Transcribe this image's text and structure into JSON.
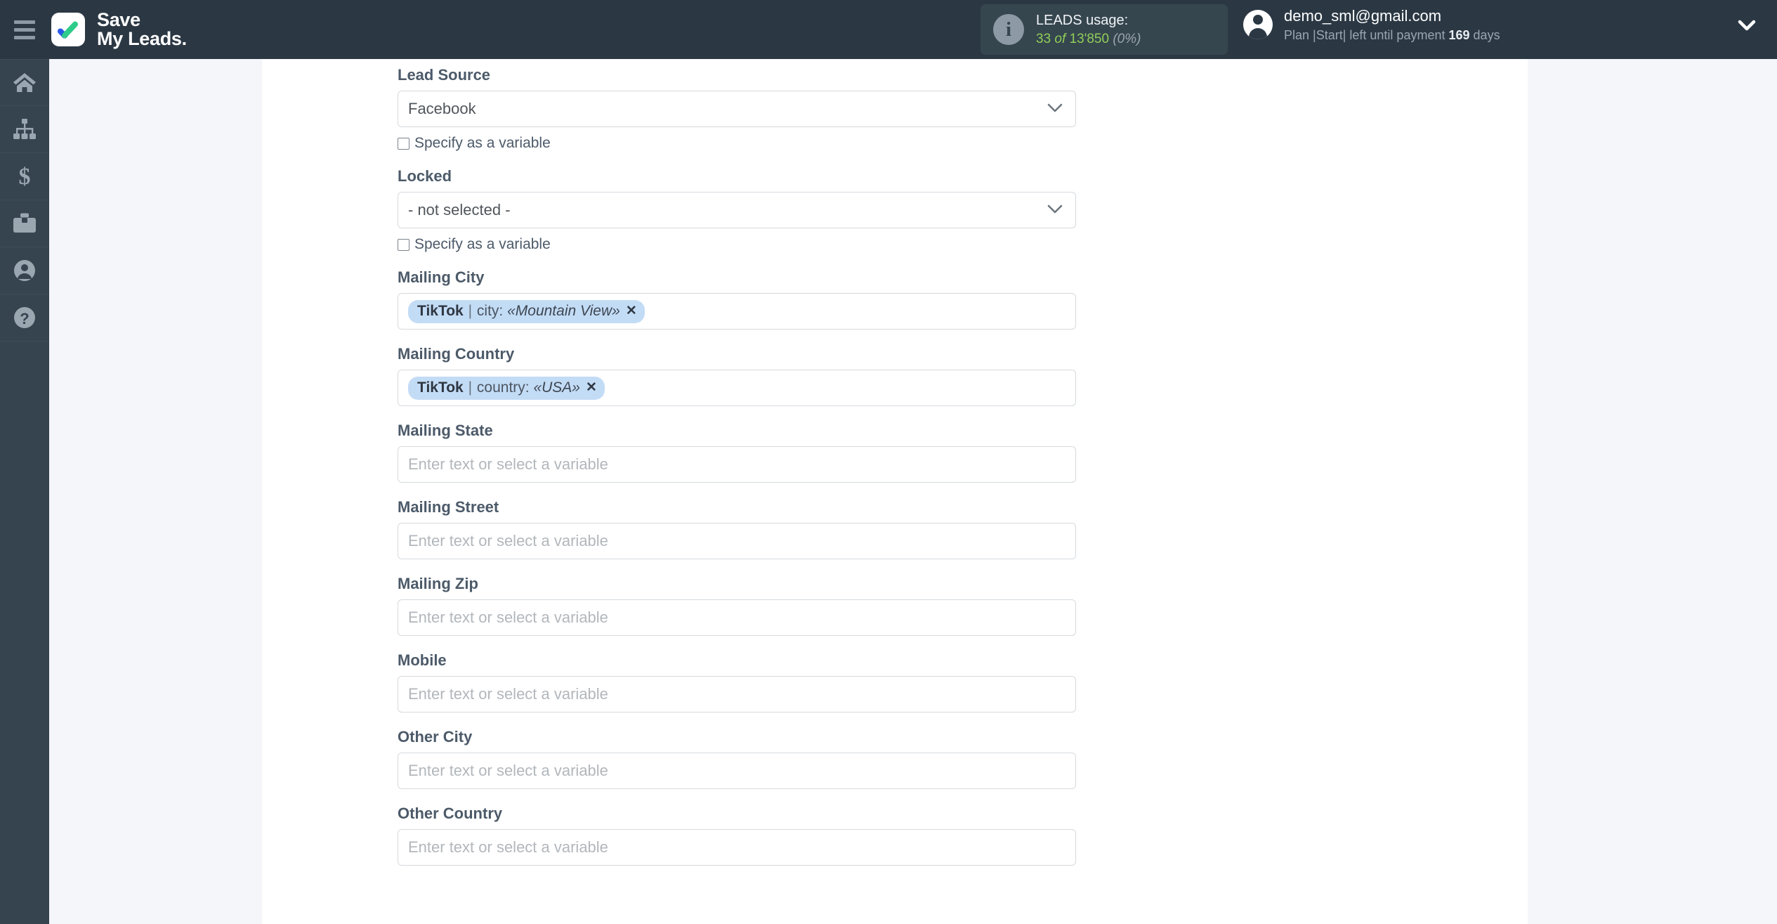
{
  "brand": {
    "name_line1": "Save",
    "name_line2": "My Leads.",
    "logo_icon": "checkmark-logo-icon",
    "menu_icon": "hamburger-menu-icon",
    "colors": {
      "blue": "#2a5ae8",
      "green": "#2ecc8a",
      "topbar": "#2b3844",
      "sidebar": "#36444f",
      "chip": "#c3dcf6"
    }
  },
  "usage": {
    "icon": "info-circle-icon",
    "title": "LEADS usage:",
    "used": "33",
    "of": "of",
    "limit": "13'850",
    "percent": "(0%)"
  },
  "account": {
    "avatar_icon": "user-avatar-icon",
    "email": "demo_sml@gmail.com",
    "plan_prefix": "Plan |Start| left until payment",
    "days_value": "169",
    "days_suffix": "days",
    "chevron_icon": "chevron-down-icon"
  },
  "sidebar": {
    "items": [
      {
        "name": "home",
        "icon": "home-icon"
      },
      {
        "name": "connections",
        "icon": "sitemap-icon"
      },
      {
        "name": "billing",
        "icon": "dollar-sign-icon"
      },
      {
        "name": "services",
        "icon": "briefcase-icon"
      },
      {
        "name": "profile",
        "icon": "user-circle-icon"
      },
      {
        "name": "help",
        "icon": "question-circle-icon"
      }
    ]
  },
  "form": {
    "checkbox_label": "Specify as a variable",
    "text_placeholder": "Enter text or select a variable",
    "caret_icon": "chevron-down-icon",
    "fields": [
      {
        "label": "Lead Source",
        "type": "select",
        "value": "Facebook",
        "has_checkbox": true
      },
      {
        "label": "Locked",
        "type": "select",
        "value": "- not selected -",
        "has_checkbox": true
      },
      {
        "label": "Mailing City",
        "type": "chip",
        "chip": {
          "source": "TikTok",
          "separator": "|",
          "key": "city:",
          "value": "«Mountain View»",
          "remove": "✕"
        },
        "has_checkbox": false
      },
      {
        "label": "Mailing Country",
        "type": "chip",
        "chip": {
          "source": "TikTok",
          "separator": "|",
          "key": "country:",
          "value": "«USA»",
          "remove": "✕"
        },
        "has_checkbox": false
      },
      {
        "label": "Mailing State",
        "type": "text",
        "value": "",
        "has_checkbox": false
      },
      {
        "label": "Mailing Street",
        "type": "text",
        "value": "",
        "has_checkbox": false
      },
      {
        "label": "Mailing Zip",
        "type": "text",
        "value": "",
        "has_checkbox": false
      },
      {
        "label": "Mobile",
        "type": "text",
        "value": "",
        "has_checkbox": false
      },
      {
        "label": "Other City",
        "type": "text",
        "value": "",
        "has_checkbox": false
      },
      {
        "label": "Other Country",
        "type": "text",
        "value": "",
        "has_checkbox": false
      }
    ]
  }
}
